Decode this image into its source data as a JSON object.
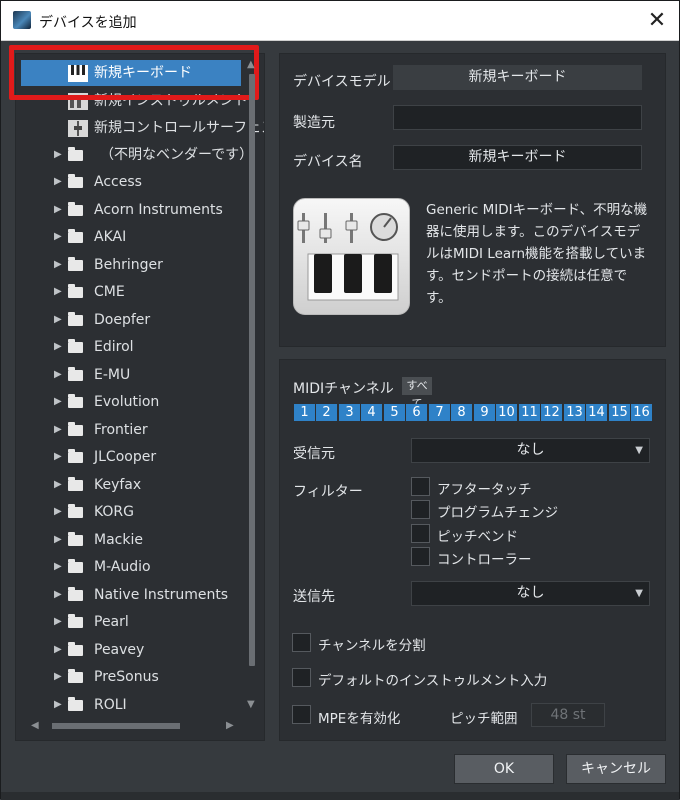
{
  "window": {
    "title": "デバイスを追加",
    "close_glyph": "✕"
  },
  "tree": {
    "selected_item": "新規キーボード",
    "items": [
      "新規インストゥルメント",
      "新規コントロールサーフェス",
      "（不明なベンダーです）",
      "Access",
      "Acorn Instruments",
      "AKAI",
      "Behringer",
      "CME",
      "Doepfer",
      "Edirol",
      "E-MU",
      "Evolution",
      "Frontier",
      "JLCooper",
      "Keyfax",
      "KORG",
      "Mackie",
      "M-Audio",
      "Native Instruments",
      "Pearl",
      "Peavey",
      "PreSonus",
      "ROLI"
    ]
  },
  "device": {
    "model_label": "デバイスモデル",
    "model_value": "新規キーボード",
    "manufacturer_label": "製造元",
    "manufacturer_value": "",
    "name_label": "デバイス名",
    "name_value": "新規キーボード",
    "description": "Generic MIDIキーボード、不明な機器に使用します。このデバイスモデルはMIDI Learn機能を搭載しています。センドポートの接続は任意です。"
  },
  "midi": {
    "channel_label": "MIDIチャンネル",
    "all_label": "すべて",
    "channels": [
      "1",
      "2",
      "3",
      "4",
      "5",
      "6",
      "7",
      "8",
      "9",
      "10",
      "11",
      "12",
      "13",
      "14",
      "15",
      "16"
    ],
    "receive_label": "受信元",
    "receive_value": "なし",
    "filter_label": "フィルター",
    "filters": [
      "アフタータッチ",
      "プログラムチェンジ",
      "ピッチベンド",
      "コントローラー"
    ],
    "send_label": "送信先",
    "send_value": "なし",
    "split_channels": "チャンネルを分割",
    "default_input": "デフォルトのインストゥルメント入力",
    "mpe_enable": "MPEを有効化",
    "pitch_range_label": "ピッチ範囲",
    "pitch_range_value": "48 st"
  },
  "buttons": {
    "ok": "OK",
    "cancel": "キャンセル"
  },
  "colors": {
    "selection": "#3b82c2",
    "channel_button": "#2f82c8",
    "highlight_box": "#e11a1a"
  }
}
